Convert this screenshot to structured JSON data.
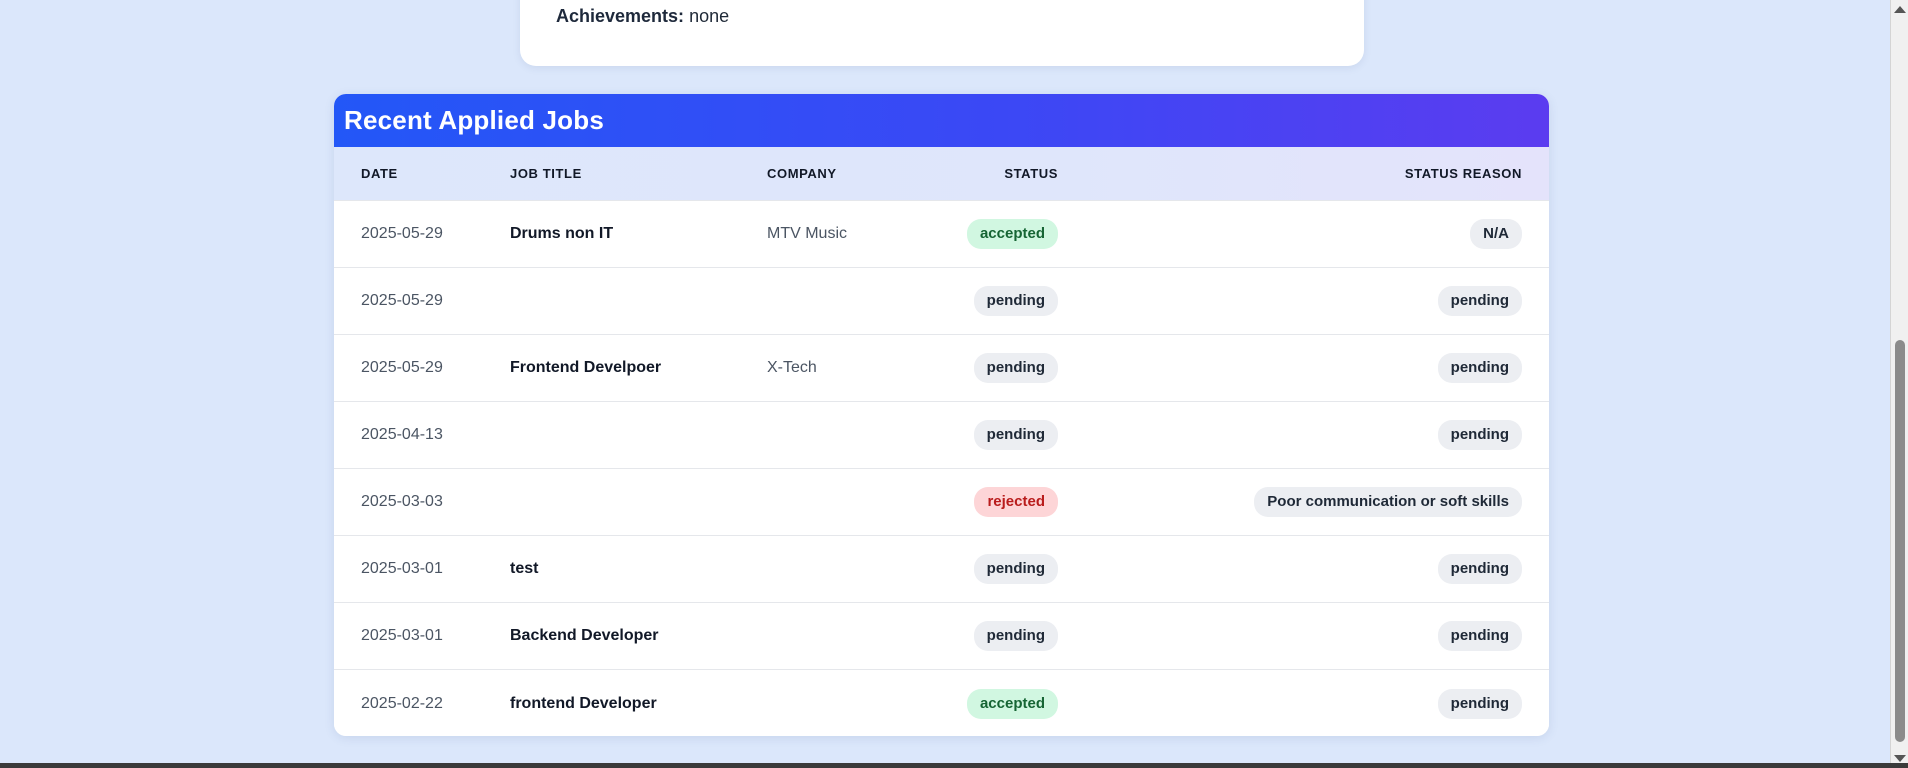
{
  "profile": {
    "achievements_label": "Achievements:",
    "achievements_value": "none"
  },
  "jobs": {
    "title": "Recent Applied Jobs",
    "columns": {
      "date": "Date",
      "job_title": "Job Title",
      "company": "Company",
      "status": "Status",
      "status_reason": "Status Reason"
    },
    "rows": [
      {
        "date": "2025-05-29",
        "title": "Drums non IT",
        "company": "MTV Music",
        "status": "accepted",
        "reason": "N/A"
      },
      {
        "date": "2025-05-29",
        "title": "",
        "company": "",
        "status": "pending",
        "reason": "pending"
      },
      {
        "date": "2025-05-29",
        "title": "Frontend Develpoer",
        "company": "X-Tech",
        "status": "pending",
        "reason": "pending"
      },
      {
        "date": "2025-04-13",
        "title": "",
        "company": "",
        "status": "pending",
        "reason": "pending"
      },
      {
        "date": "2025-03-03",
        "title": "",
        "company": "",
        "status": "rejected",
        "reason": "Poor communication or soft skills"
      },
      {
        "date": "2025-03-01",
        "title": "test",
        "company": "",
        "status": "pending",
        "reason": "pending"
      },
      {
        "date": "2025-03-01",
        "title": "Backend Developer",
        "company": "",
        "status": "pending",
        "reason": "pending"
      },
      {
        "date": "2025-02-22",
        "title": "frontend Developer",
        "company": "",
        "status": "accepted",
        "reason": "pending"
      }
    ]
  },
  "colors": {
    "page_bg": "#dbe7fb",
    "header_gradient_start": "#2357f7",
    "header_gradient_end": "#5b3cf0",
    "accepted_bg": "#d1f7e1",
    "rejected_bg": "#fdd5d7",
    "pending_bg": "#eceef2"
  }
}
